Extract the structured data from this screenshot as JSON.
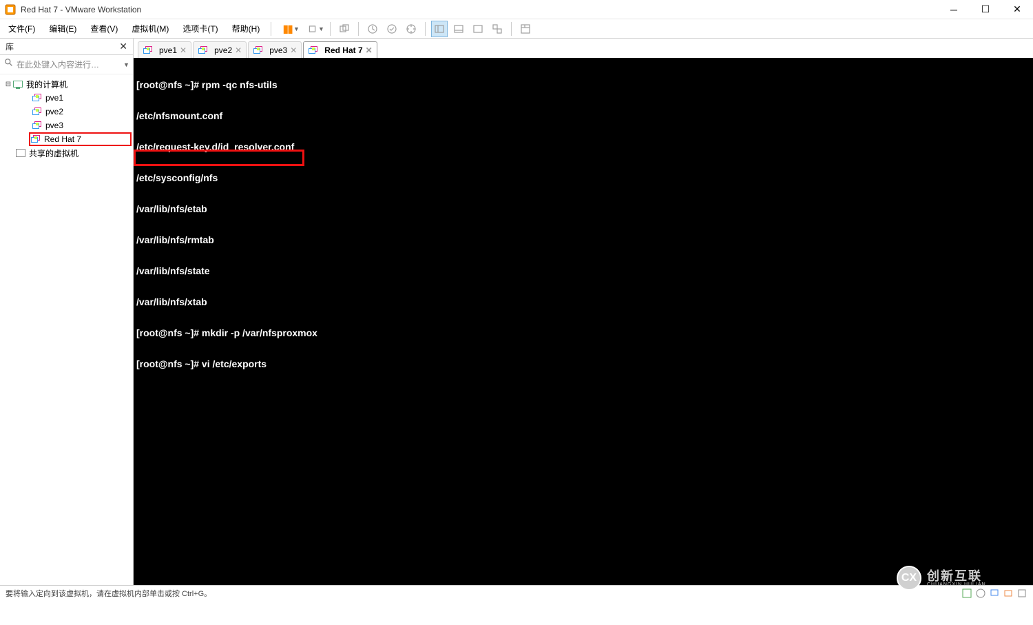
{
  "window": {
    "title": "Red Hat 7 - VMware Workstation"
  },
  "menubar": {
    "file": "文件(F)",
    "edit": "编辑(E)",
    "view": "查看(V)",
    "vm": "虚拟机(M)",
    "tabs": "选项卡(T)",
    "help": "帮助(H)"
  },
  "sidebar": {
    "title": "库",
    "search_placeholder": "在此处键入内容进行…",
    "tree": {
      "root": "我的计算机",
      "pve1": "pve1",
      "pve2": "pve2",
      "pve3": "pve3",
      "redhat7": "Red Hat 7",
      "shared": "共享的虚拟机"
    }
  },
  "tabs": {
    "pve1": "pve1",
    "pve2": "pve2",
    "pve3": "pve3",
    "redhat7": "Red Hat 7"
  },
  "terminal": {
    "lines": [
      "[root@nfs ~]# rpm -qc nfs-utils",
      "/etc/nfsmount.conf",
      "/etc/request-key.d/id_resolver.conf",
      "/etc/sysconfig/nfs",
      "/var/lib/nfs/etab",
      "/var/lib/nfs/rmtab",
      "/var/lib/nfs/state",
      "/var/lib/nfs/xtab",
      "[root@nfs ~]# mkdir -p /var/nfsproxmox",
      "[root@nfs ~]# vi /etc/exports"
    ]
  },
  "statusbar": {
    "message": "要将输入定向到该虚拟机，请在虚拟机内部单击或按 Ctrl+G。"
  },
  "watermark": {
    "logo_text": "CX",
    "cn": "创新互联",
    "en": "CHUANGXIN HULIAN"
  }
}
